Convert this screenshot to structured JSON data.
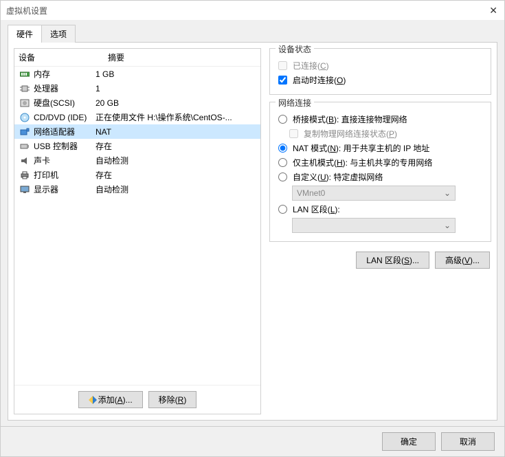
{
  "window": {
    "title": "虚拟机设置"
  },
  "tabs": {
    "hardware": "硬件",
    "options": "选项"
  },
  "columns": {
    "device": "设备",
    "summary": "摘要"
  },
  "hw": [
    {
      "name": "内存",
      "summary": "1 GB"
    },
    {
      "name": "处理器",
      "summary": "1"
    },
    {
      "name": "硬盘(SCSI)",
      "summary": "20 GB"
    },
    {
      "name": "CD/DVD (IDE)",
      "summary": "正在使用文件 H:\\操作系统\\CentOS-..."
    },
    {
      "name": "网络适配器",
      "summary": "NAT"
    },
    {
      "name": "USB 控制器",
      "summary": "存在"
    },
    {
      "name": "声卡",
      "summary": "自动检测"
    },
    {
      "name": "打印机",
      "summary": "存在"
    },
    {
      "name": "显示器",
      "summary": "自动检测"
    }
  ],
  "hw_btns": {
    "add": "添加(A)...",
    "remove": "移除(R)"
  },
  "status": {
    "legend": "设备状态",
    "connected": "已连接(C)",
    "connect_on_power": "启动时连接(O)"
  },
  "net": {
    "legend": "网络连接",
    "bridged": "桥接模式(B): 直接连接物理网络",
    "replicate": "复制物理网络连接状态(P)",
    "nat": "NAT 模式(N): 用于共享主机的 IP 地址",
    "hostonly": "仅主机模式(H): 与主机共享的专用网络",
    "custom": "自定义(U): 特定虚拟网络",
    "custom_value": "VMnet0",
    "lan": "LAN 区段(L):",
    "lan_value": ""
  },
  "right_btns": {
    "lan": "LAN 区段(S)...",
    "advanced": "高级(V)..."
  },
  "footer": {
    "ok": "确定",
    "cancel": "取消"
  }
}
